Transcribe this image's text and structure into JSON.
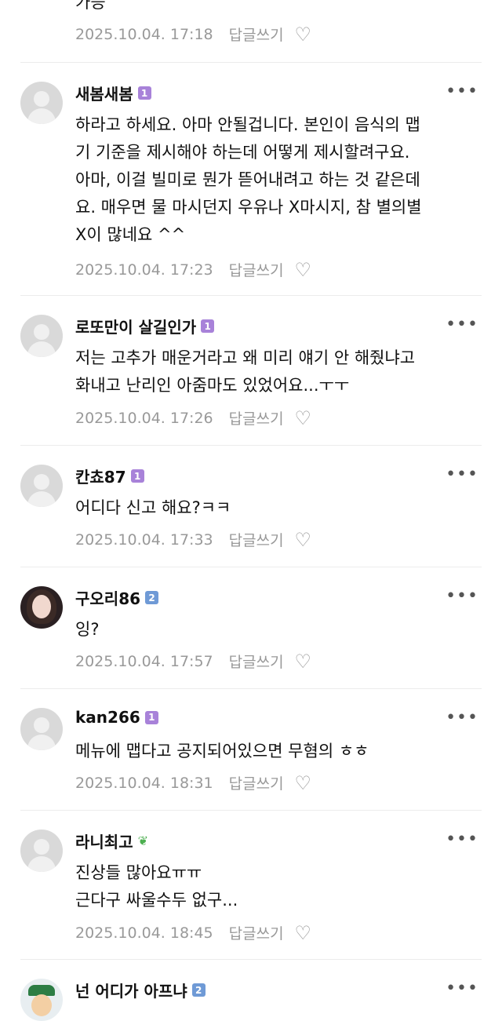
{
  "top_partial": {
    "text": "가능",
    "timestamp": "2025.10.04. 17:18",
    "reply_label": "답글쓰기"
  },
  "comments": [
    {
      "nickname": "새봄새봄",
      "badge": "1",
      "lines": [
        "하라고 하세요. 아마 안될겁니다. 본인이 음식의 맵",
        "기 기준을 제시해야 하는데 어떻게 제시할려구요.",
        "아마, 이걸 빌미로 뭔가 뜯어내려고 하는 것 같은데",
        "요. 매우면 물 마시던지 우유나 X마시지, 참 별의별",
        "X이 많네요 ^^"
      ],
      "timestamp": "2025.10.04. 17:23",
      "reply_label": "답글쓰기"
    },
    {
      "nickname": "로또만이 살길인가",
      "badge": "1",
      "lines": [
        "저는 고추가 매운거라고 왜 미리 얘기 안 해줬냐고",
        "화내고 난리인 아줌마도 있었어요...ㅜㅜ"
      ],
      "timestamp": "2025.10.04. 17:26",
      "reply_label": "답글쓰기"
    },
    {
      "nickname": "칸쵸87",
      "badge": "1",
      "lines": [
        "어디다 신고 해요?ㅋㅋ"
      ],
      "timestamp": "2025.10.04. 17:33",
      "reply_label": "답글쓰기"
    },
    {
      "nickname": "구오리86",
      "badge": "2",
      "lines": [
        "잉?"
      ],
      "timestamp": "2025.10.04. 17:57",
      "reply_label": "답글쓰기"
    },
    {
      "nickname": "kan266",
      "badge": "1",
      "lines": [
        "메뉴에 맵다고 공지되어있으면 무혐의 ㅎㅎ"
      ],
      "timestamp": "2025.10.04. 18:31",
      "reply_label": "답글쓰기"
    },
    {
      "nickname": "라니최고",
      "badge": "sprout",
      "lines": [
        "진상들 많아요ㅠㅠ",
        "근다구 싸울수두 없구..."
      ],
      "timestamp": "2025.10.04. 18:45",
      "reply_label": "답글쓰기"
    },
    {
      "nickname": "넌 어디가 아프냐",
      "badge": "2",
      "lines": [],
      "timestamp": "",
      "reply_label": ""
    }
  ],
  "icons": {
    "heart": "heart-outline-icon",
    "more": "more-dots-icon",
    "sprout": "sprout-icon"
  },
  "colors": {
    "badge_lv1": "#a882d9",
    "badge_lv2": "#6f9ad6",
    "meta": "#999999"
  }
}
